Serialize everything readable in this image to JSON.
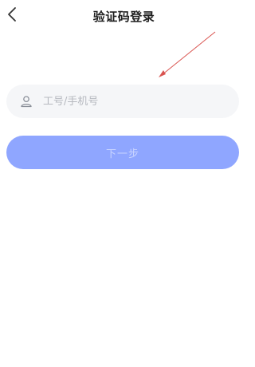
{
  "header": {
    "title": "验证码登录",
    "back_icon": "chevron-left-icon"
  },
  "login_form": {
    "account_input": {
      "icon": "user-icon",
      "value": "",
      "placeholder": "工号/手机号"
    },
    "next_button_label": "下一步"
  },
  "colors": {
    "primary_button": "#8fa6ff",
    "button_text": "#c9d4ff",
    "input_background": "#f5f6f8",
    "annotation_arrow": "#d9534f"
  }
}
